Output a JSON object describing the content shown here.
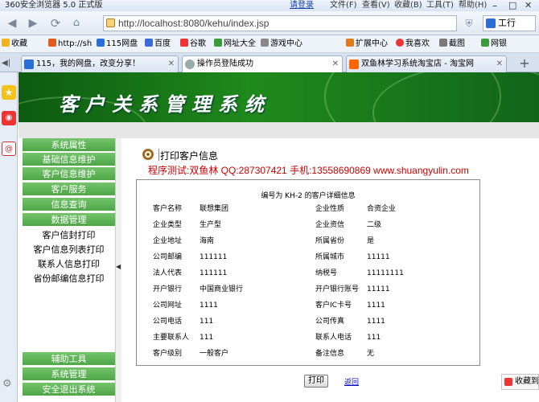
{
  "browser": {
    "window_title": "360安全浏览器 5.0 正式版",
    "menu": [
      "请登录",
      "文件(F)",
      "查看(V)",
      "收藏(B)",
      "工具(T)",
      "帮助(H)"
    ],
    "url": "http://localhost:8080/kehu/index.jsp",
    "search_text": "工行",
    "bookmarks": [
      "收藏",
      "http://sh",
      "115网盘",
      "百度",
      "谷歌",
      "网址大全",
      "游戏中心",
      "扩展中心",
      "我喜欢",
      "截图",
      "网银"
    ],
    "tabs": [
      {
        "title": "115，我的网盘，改变分享！",
        "active": false
      },
      {
        "title": "操作员登陆成功",
        "active": true
      },
      {
        "title": "双鱼林学习系统淘宝店 - 淘宝网",
        "active": false
      }
    ],
    "new_tab": "+",
    "fav_button": "收藏到"
  },
  "app": {
    "banner_title": "客户关系管理系统",
    "menu": {
      "main_items": [
        "系统属性",
        "基础信息维护",
        "客户信息维护",
        "客户服务",
        "信息查询",
        "数据管理"
      ],
      "sub_items": [
        "客户信封打印",
        "客户信息列表打印",
        "联系人信息打印",
        "省份邮编信息打印"
      ],
      "bottom_items": [
        "辅助工具",
        "系统管理",
        "安全退出系统"
      ]
    },
    "content": {
      "heading": "打印客户信息",
      "author_line": "程序测试:双鱼林 QQ:287307421 手机:13558690869 www.shuangyulin.com",
      "detail_title": "编号为 KH-2 的客户详细信息",
      "rows": [
        {
          "l1": "客户名称",
          "v1": "联想集团",
          "l2": "企业性质",
          "v2": "合资企业"
        },
        {
          "l1": "企业类型",
          "v1": "生产型",
          "l2": "企业资信",
          "v2": "二级"
        },
        {
          "l1": "企业地址",
          "v1": "海南",
          "l2": "所属省份",
          "v2": "是"
        },
        {
          "l1": "公司邮编",
          "v1": "111111",
          "l2": "所属城市",
          "v2": "11111"
        },
        {
          "l1": "法人代表",
          "v1": "111111",
          "l2": "纳税号",
          "v2": "11111111"
        },
        {
          "l1": "开户银行",
          "v1": "中国商业银行",
          "l2": "开户银行账号",
          "v2": "11111"
        },
        {
          "l1": "公司网址",
          "v1": "1111",
          "l2": "客户IC卡号",
          "v2": "1111"
        },
        {
          "l1": "公司电话",
          "v1": "111",
          "l2": "公司传真",
          "v2": "1111"
        },
        {
          "l1": "主要联系人",
          "v1": "111",
          "l2": "联系人电话",
          "v2": "111"
        },
        {
          "l1": "客户级别",
          "v1": "一般客户",
          "l2": "备注信息",
          "v2": "无"
        }
      ],
      "print_button": "打印",
      "back_link": "返回"
    }
  }
}
